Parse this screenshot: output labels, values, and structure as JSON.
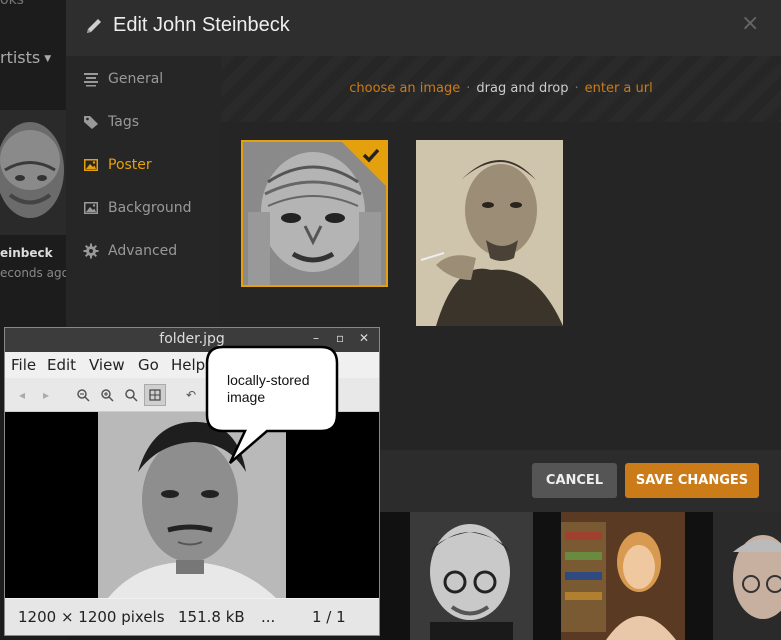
{
  "background": {
    "nav_top": "oks",
    "section": "rtists",
    "artist_name": "einbeck",
    "artist_time": "econds ago"
  },
  "modal": {
    "title": "Edit John Steinbeck",
    "close": "×",
    "sidebar": [
      {
        "label": "General",
        "icon": "general-icon",
        "active": false
      },
      {
        "label": "Tags",
        "icon": "tag-icon",
        "active": false
      },
      {
        "label": "Poster",
        "icon": "image-icon",
        "active": true
      },
      {
        "label": "Background",
        "icon": "image-icon",
        "active": false
      },
      {
        "label": "Advanced",
        "icon": "gear-icon",
        "active": false
      }
    ],
    "sources": {
      "choose": "choose an image",
      "drag": "drag and drop",
      "url": "enter a url",
      "separator": "·"
    },
    "buttons": {
      "cancel": "CANCEL",
      "save": "SAVE CHANGES"
    }
  },
  "viewer": {
    "title": "folder.jpg",
    "menu": [
      "File",
      "Edit",
      "View",
      "Go",
      "Help"
    ],
    "status": {
      "dimensions": "1200 × 1200 pixels",
      "size": "151.8 kB",
      "ellipsis": "...",
      "page": "1 / 1"
    }
  },
  "bubble": {
    "line1": "locally-stored",
    "line2": "image"
  },
  "colors": {
    "accent": "#e5a00d",
    "button_orange": "#cc7b19"
  }
}
